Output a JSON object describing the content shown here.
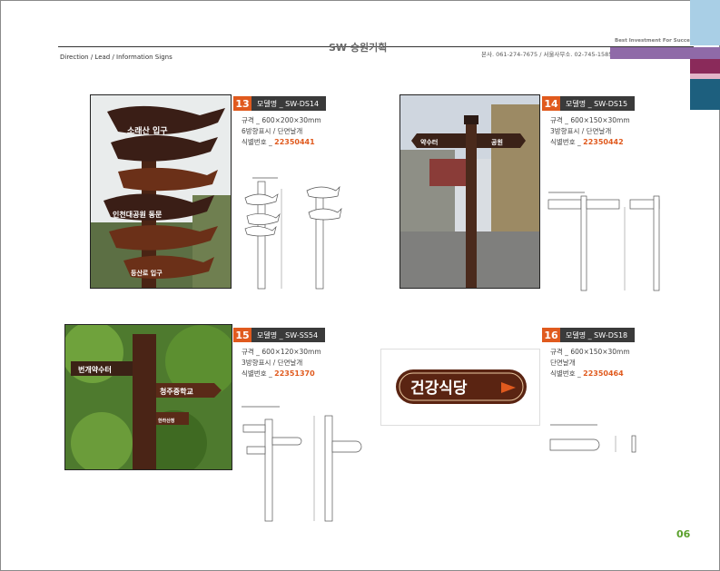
{
  "header": {
    "category": "Direction / Lead / Information Signs",
    "logo": "SW 승원기획",
    "contact": "본사. 061-274-7675 / 서울사무소. 02-745-1585",
    "tagline": "Best Investment For Success"
  },
  "colors": {
    "accent_orange": "#e05a1e",
    "label_dark": "#3a3a3a",
    "wood": "#5a2e1e",
    "bar_blue": "#a9cfe6",
    "bar_purple": "#8f6aa8",
    "bar_magenta": "#8a2a5a",
    "bar_teal": "#1d5f7e",
    "page_num": "#5aa02c"
  },
  "products": [
    {
      "number": "13",
      "model": "모델명 _ SW-DS14",
      "spec_size": "규격 _ 600×200×30mm",
      "spec_type": "6방향표시 / 단면날개",
      "code_label": "식별번호 _ ",
      "code": "22350441",
      "photo_signs": [
        "소래산 입구",
        "인천대공원 동문",
        "등산로 입구"
      ]
    },
    {
      "number": "14",
      "model": "모델명 _ SW-DS15",
      "spec_size": "규격 _ 600×150×30mm",
      "spec_type": "3방향표시 / 단면날개",
      "code_label": "식별번호 _ ",
      "code": "22350442",
      "photo_signs": [
        "약수터",
        "공원"
      ]
    },
    {
      "number": "15",
      "model": "모델명 _ SW-SS54",
      "spec_size": "규격 _ 600×120×30mm",
      "spec_type": "3방향표시 / 단면날개",
      "code_label": "식별번호 _ ",
      "code": "22351370",
      "photo_signs": [
        "번개약수터",
        "청주중학교",
        "한라산정"
      ]
    },
    {
      "number": "16",
      "model": "모델명 _ SW-DS18",
      "spec_size": "규격 _ 600×150×30mm",
      "spec_type": "단면날개",
      "code_label": "식별번호 _ ",
      "code": "22350464",
      "photo_signs": [
        "건강식당"
      ]
    }
  ],
  "watermark": "SW 승원기획",
  "page_number": "06"
}
